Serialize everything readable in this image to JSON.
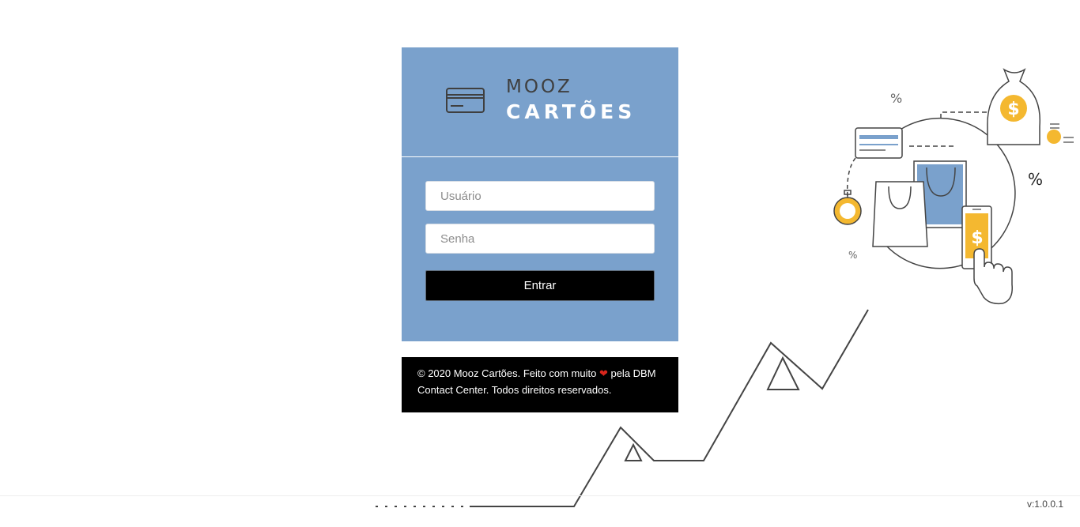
{
  "brand": {
    "name_top": "MOOZ",
    "name_bottom": "CARTÕES",
    "colors": {
      "panel": "#7aa1cc",
      "button": "#000000",
      "accent": "#f4b830",
      "heart": "#d9261c"
    }
  },
  "login": {
    "username_placeholder": "Usuário",
    "password_placeholder": "Senha",
    "submit_label": "Entrar"
  },
  "footer": {
    "text_before_heart": "© 2020 Mooz Cartões. Feito com muito ",
    "heart_icon": "heart-icon",
    "text_after_heart": " pela DBM Contact Center. Todos direitos reservados."
  },
  "illustration": {
    "percent_symbol": "%",
    "dollar_symbol": "$",
    "icons": [
      "credit-card-icon",
      "money-bag-icon",
      "coin-icon",
      "shopping-bag-icon",
      "stopwatch-icon",
      "phone-icon",
      "hand-icon"
    ]
  },
  "version": "v:1.0.0.1"
}
